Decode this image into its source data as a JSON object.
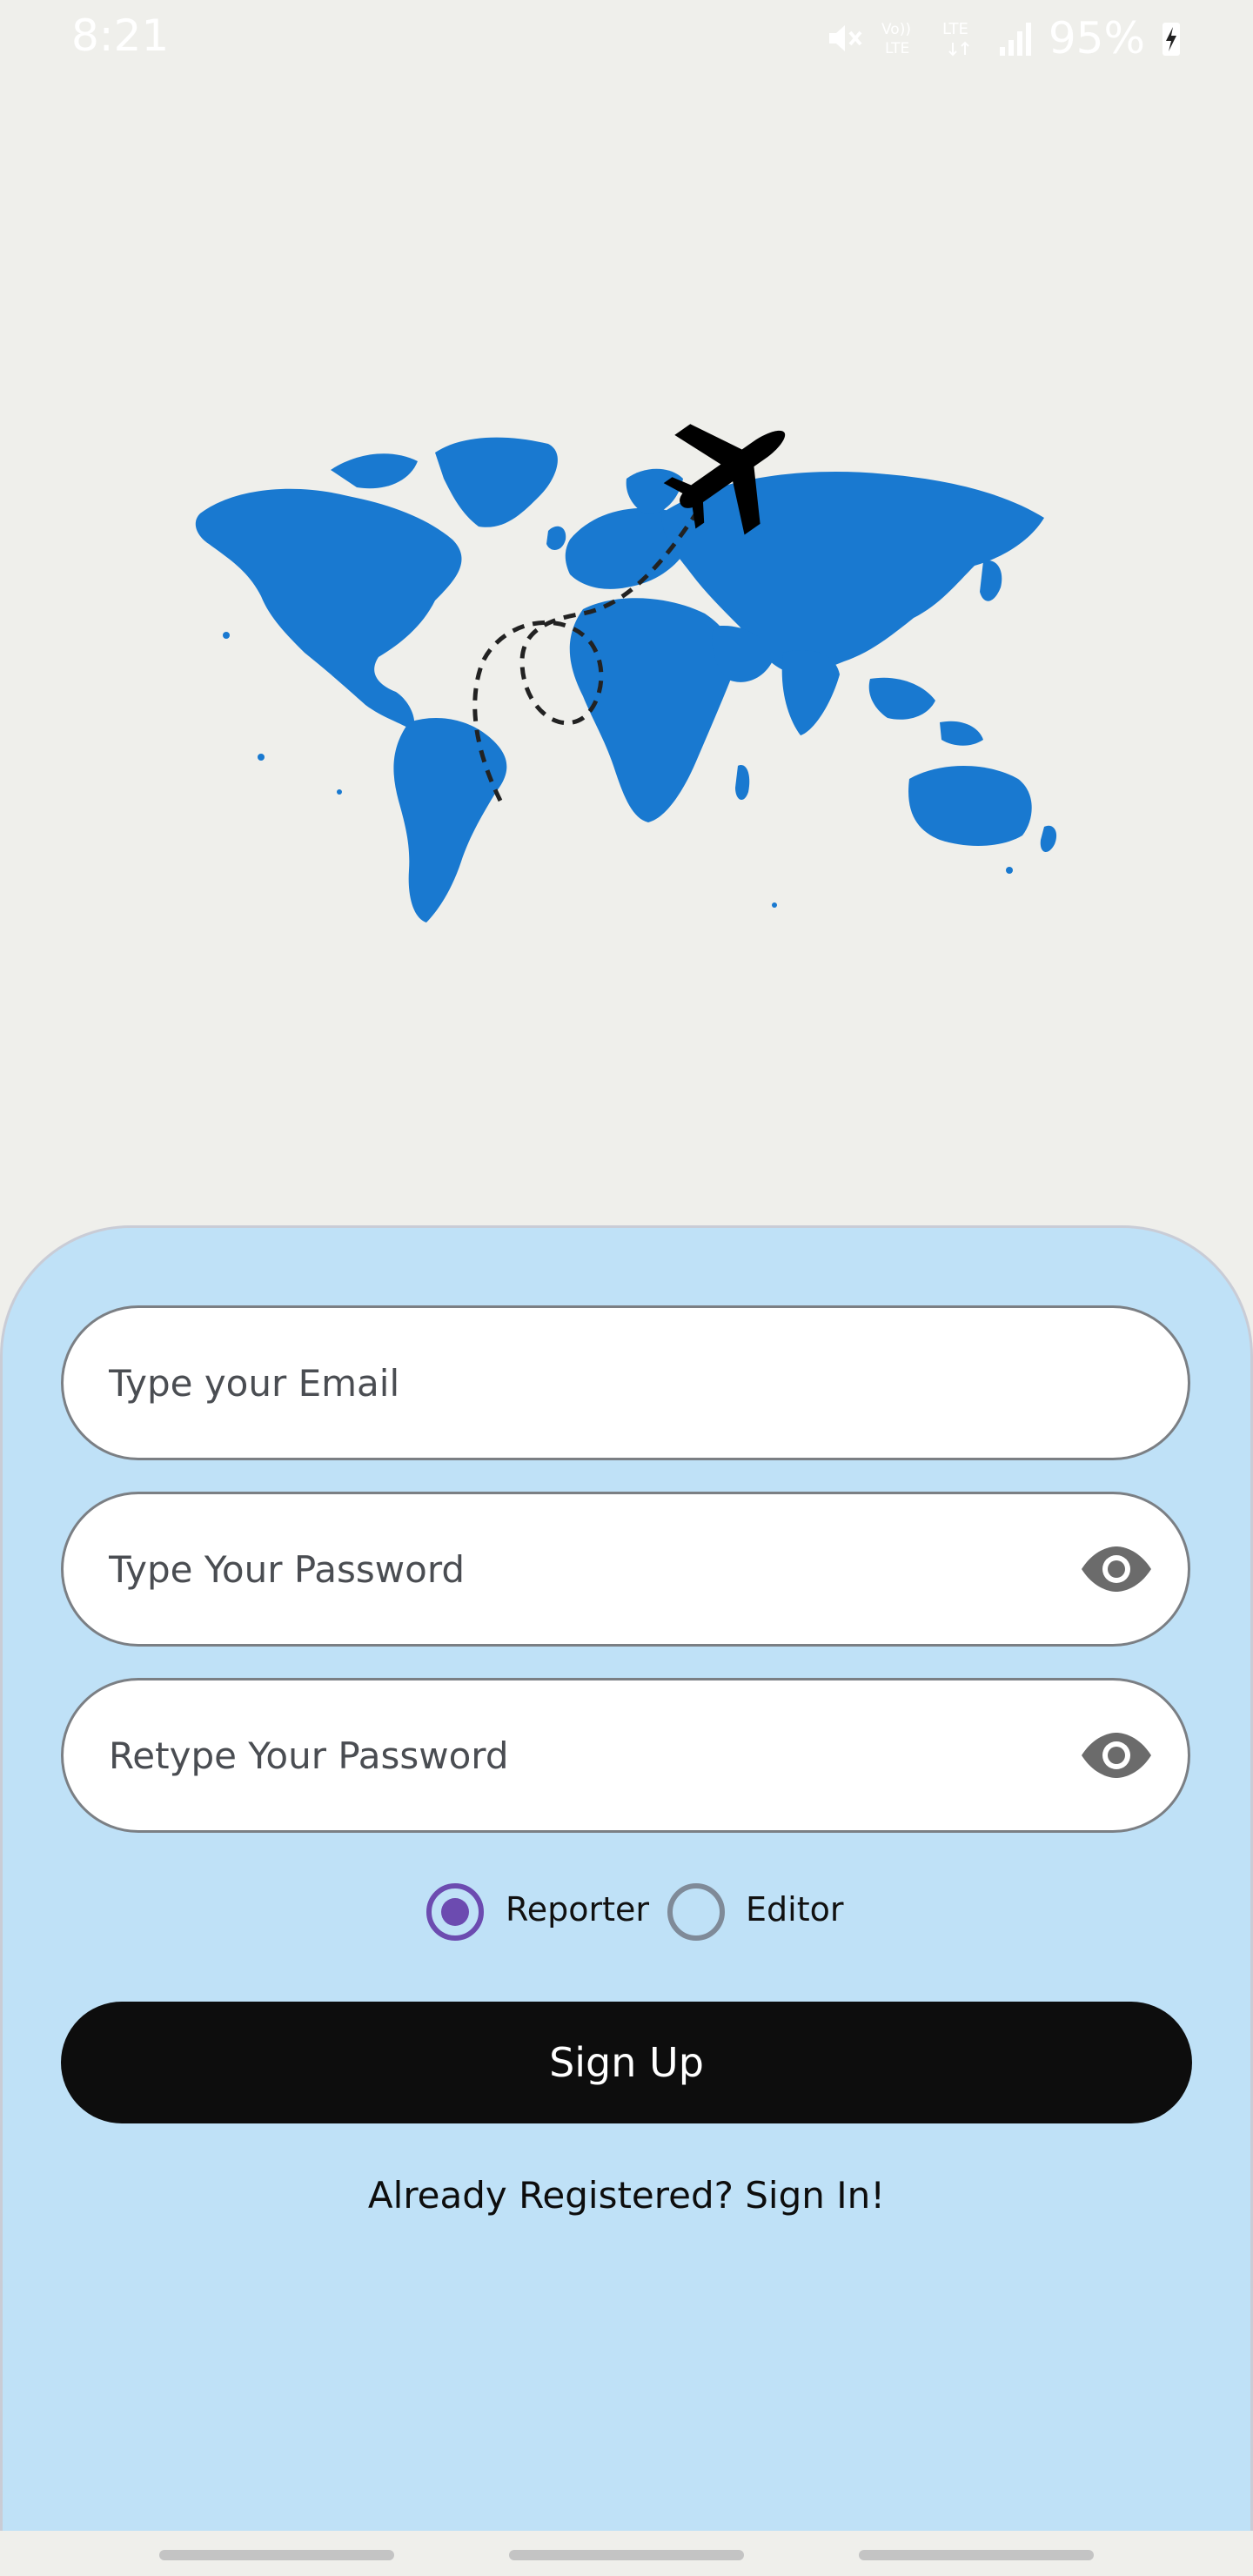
{
  "status_bar": {
    "time": "8:21",
    "battery": "95%"
  },
  "form": {
    "email_placeholder": "Type your Email",
    "password_placeholder": "Type Your Password",
    "retype_placeholder": "Retype Your Password"
  },
  "roles": {
    "reporter_label": "Reporter",
    "editor_label": "Editor",
    "selected": "Reporter"
  },
  "actions": {
    "signup_label": "Sign Up",
    "signin_link": "Already Registered? Sign In!"
  },
  "colors": {
    "sheet_background": "#bfe1f7",
    "map_blue": "#1979d0",
    "radio_selected": "#6c4bb0",
    "button_background": "#0d0d0d"
  }
}
